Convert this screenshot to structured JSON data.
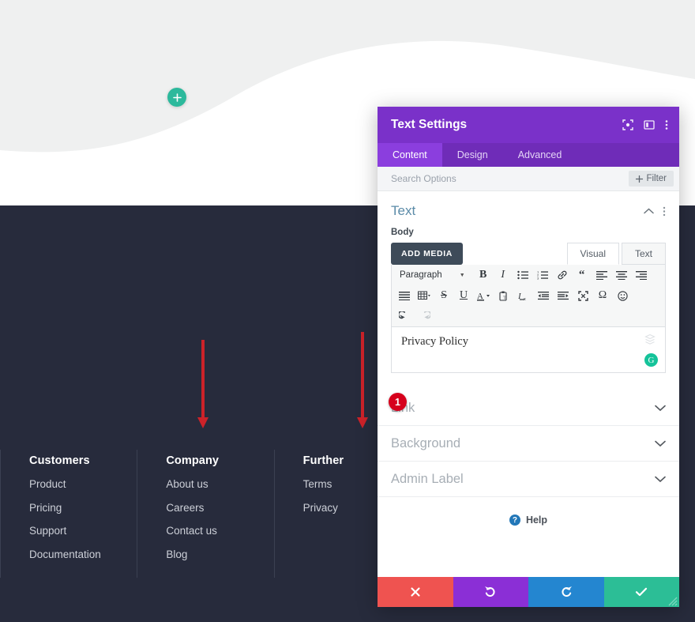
{
  "page": {
    "add_module_icon": "plus-icon",
    "colors": {
      "page_top": "#eff0f0",
      "wave_white": "#ffffff",
      "page_navy": "#272b3c",
      "accent_teal": "#2cb99c",
      "annotation_red": "#cc2229",
      "modal_purple": "#7a31c9",
      "tab_purple_active": "#8b3ede",
      "badge_red": "#d6001c"
    }
  },
  "footer": {
    "columns": [
      {
        "heading": "Customers",
        "links": [
          "Product",
          "Pricing",
          "Support",
          "Documentation"
        ]
      },
      {
        "heading": "Company",
        "links": [
          "About us",
          "Careers",
          "Contact us",
          "Blog"
        ]
      },
      {
        "heading": "Further",
        "links": [
          "Terms",
          "Privacy"
        ]
      }
    ]
  },
  "annotations": {
    "arrow_left": "down-arrow-icon",
    "arrow_right": "down-arrow-icon",
    "step_badge": "1"
  },
  "modal": {
    "title": "Text Settings",
    "header_icons": [
      {
        "name": "focus-icon"
      },
      {
        "name": "panel-layout-icon"
      },
      {
        "name": "kebab-menu-icon"
      }
    ],
    "tabs": [
      {
        "label": "Content",
        "active": true
      },
      {
        "label": "Design",
        "active": false
      },
      {
        "label": "Advanced",
        "active": false
      }
    ],
    "search": {
      "value": "",
      "placeholder": "Search Options"
    },
    "filter_button": {
      "label": "Filter",
      "icon": "plus-icon"
    },
    "section": {
      "title": "Text",
      "collapse_icon": "chevron-up-icon",
      "menu_icon": "kebab-menu-icon",
      "field_label": "Body"
    },
    "editor": {
      "add_media_label": "ADD MEDIA",
      "mode_tabs": [
        {
          "label": "Visual",
          "active": true
        },
        {
          "label": "Text",
          "active": false
        }
      ],
      "format_select": "Paragraph",
      "toolbar_row1": [
        "bold-icon",
        "italic-icon",
        "bulleted-list-icon",
        "numbered-list-icon",
        "link-icon",
        "blockquote-icon",
        "align-left-icon",
        "align-center-icon",
        "align-right-icon"
      ],
      "toolbar_row2": [
        "align-justify-icon",
        "table-icon",
        "strikethrough-icon",
        "underline-icon",
        "text-color-icon",
        "paste-as-text-icon",
        "clear-formatting-icon",
        "outdent-icon",
        "indent-icon",
        "fullscreen-icon",
        "special-character-icon",
        "emoji-icon"
      ],
      "toolbar_row3": [
        "undo-icon",
        "redo-icon"
      ],
      "content": "Privacy Policy",
      "layers_icon": "layers-icon",
      "grammar_badge": "G"
    },
    "accordions": [
      {
        "label": "Link",
        "icon": "chevron-down-icon"
      },
      {
        "label": "Background",
        "icon": "chevron-down-icon"
      },
      {
        "label": "Admin Label",
        "icon": "chevron-down-icon"
      }
    ],
    "help": {
      "label": "Help",
      "icon": "question-mark-icon"
    },
    "actions": [
      {
        "name": "cancel-button",
        "icon": "close-icon",
        "color": "#ef5350"
      },
      {
        "name": "undo-button",
        "icon": "undo-icon",
        "color": "#8b2fd6"
      },
      {
        "name": "redo-button",
        "icon": "redo-icon",
        "color": "#2486d0"
      },
      {
        "name": "save-button",
        "icon": "check-icon",
        "color": "#2cbe96"
      }
    ],
    "resize_handle": "resize-handle-icon"
  }
}
